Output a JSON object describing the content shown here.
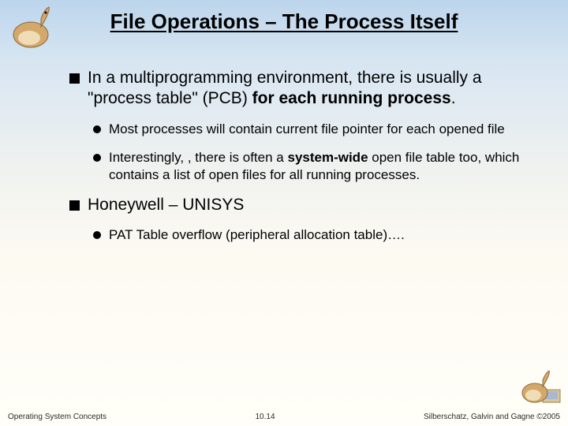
{
  "title": "File Operations – The Process Itself",
  "bullets": {
    "b1_pre": "In a multiprogramming environment, there is usually a \"process table\" (PCB) ",
    "b1_bold": "for each running process",
    "b1_post": ".",
    "b1a": "Most processes will contain current file pointer for each opened file",
    "b1b_pre": "Interestingly, , there is often a ",
    "b1b_bold": "system-wide",
    "b1b_post": " open file table too, which contains a list of open files for all running processes.",
    "b2": "Honeywell – UNISYS",
    "b2a": "PAT Table overflow (peripheral allocation table)…."
  },
  "footer": {
    "left": "Operating System Concepts",
    "center": "10.14",
    "right": "Silberschatz, Galvin and Gagne ©2005"
  }
}
